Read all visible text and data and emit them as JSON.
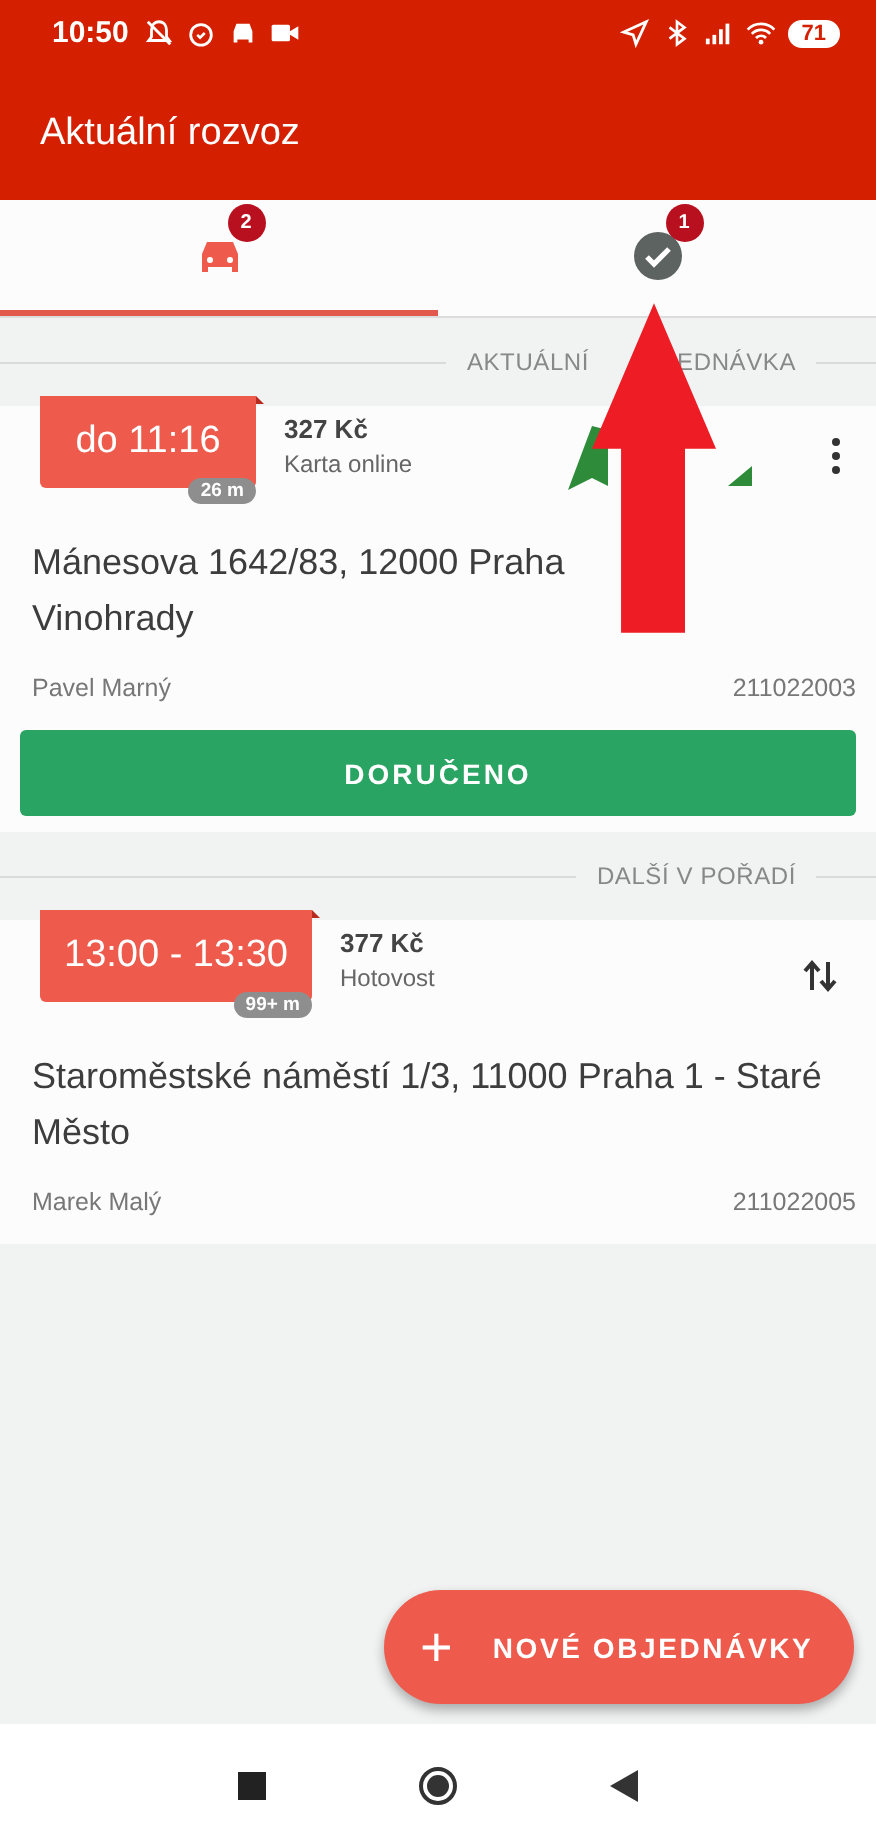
{
  "status_bar": {
    "time": "10:50",
    "battery": "71"
  },
  "app_bar": {
    "title": "Aktuální rozvoz"
  },
  "tabs": [
    {
      "kind": "car",
      "badge": "2",
      "selected": true
    },
    {
      "kind": "check",
      "badge": "1",
      "selected": false
    }
  ],
  "sections": [
    {
      "label_parts": [
        "AKTUÁLNÍ",
        "EDNÁVKA"
      ],
      "orders": [
        {
          "kind": "current",
          "time": "do 11:16",
          "distance": "26 m",
          "price": "327 Kč",
          "payment": "Karta online",
          "address_lines": [
            "Mánesova 1642/83, 12000 Praha",
            "Vinohrady"
          ],
          "customer": "Pavel Marný",
          "number": "211022003",
          "button": "DORUČENO"
        }
      ]
    },
    {
      "label_parts": [
        "DALŠÍ V POŘADÍ"
      ],
      "orders": [
        {
          "kind": "queued",
          "time": "13:00 - 13:30",
          "distance": "99+ m",
          "price": "377 Kč",
          "payment": "Hotovost",
          "address_lines": [
            "Staroměstské náměstí 1/3, 11000 Praha 1 - Staré",
            "Město"
          ],
          "customer": "Marek Malý",
          "number": "211022005"
        }
      ]
    }
  ],
  "fab": {
    "label": "NOVÉ OBJEDNÁVKY",
    "icon": "+"
  },
  "annotation": {
    "kind": "arrow"
  }
}
